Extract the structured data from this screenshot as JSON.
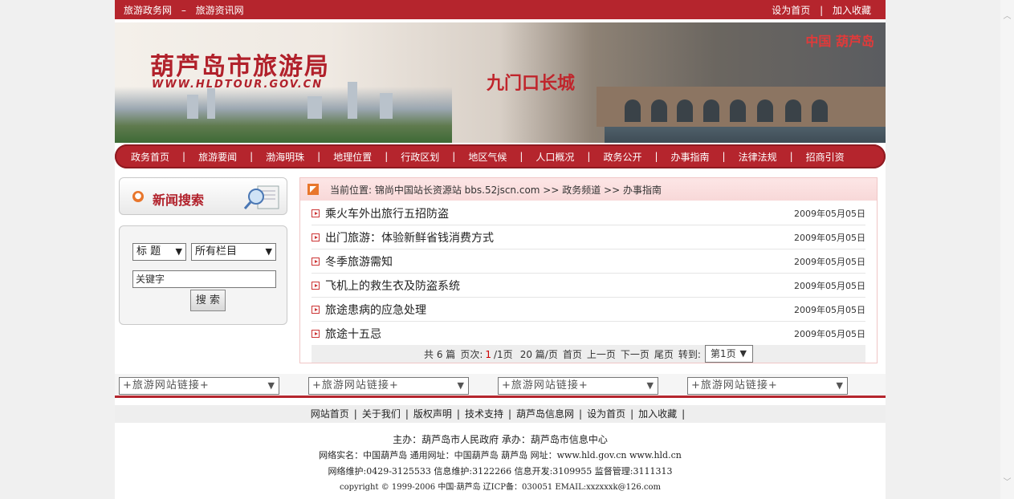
{
  "topbar": {
    "site_name": "旅游政务网",
    "dash": "–",
    "news_site": "旅游资讯网",
    "set_home": "设为首页",
    "sep": "|",
    "add_fav": "加入收藏"
  },
  "banner": {
    "logo_text": "葫芦岛市旅游局",
    "logo_url": "WWW.HLDTOUR.GOV.CN",
    "wall_title": "九门口长城",
    "region": "中国  葫芦岛"
  },
  "nav": {
    "items": [
      "政务首页",
      "旅游要闻",
      "渤海明珠",
      "地理位置",
      "行政区划",
      "地区气候",
      "人口概况",
      "政务公开",
      "办事指南",
      "法律法规",
      "招商引资"
    ],
    "divider": "|"
  },
  "search": {
    "box_title": "新闻搜索",
    "field_select": "标 题",
    "column_select": "所有栏目",
    "keyword_value": "关键字",
    "button": "搜 索"
  },
  "breadcrumb": {
    "text": "当前位置: 锦尚中国站长资源站 bbs.52jscn.com >> 政务频道 >> 办事指南"
  },
  "articles": [
    {
      "title": "乘火车外出旅行五招防盗",
      "date": "2009年05月05日"
    },
    {
      "title": "出门旅游：体验新鲜省钱消费方式",
      "date": "2009年05月05日"
    },
    {
      "title": "冬季旅游需知",
      "date": "2009年05月05日"
    },
    {
      "title": "飞机上的救生衣及防盗系统",
      "date": "2009年05月05日"
    },
    {
      "title": "旅途患病的应急处理",
      "date": "2009年05月05日"
    },
    {
      "title": "旅途十五忌",
      "date": "2009年05月05日"
    }
  ],
  "pager": {
    "total_a": "共 6 篇",
    "page_label": "页次:",
    "current": "1",
    "of_pages": "/1页",
    "per_page": "20 篇/页",
    "first": "首页",
    "prev": "上一页",
    "next": "下一页",
    "last": "尾页",
    "goto": "转到:",
    "page_select": "第1页"
  },
  "site_links": [
    "+旅游网站链接+",
    "+旅游网站链接+",
    "+旅游网站链接+",
    "+旅游网站链接+"
  ],
  "footer_nav": [
    "网站首页",
    "关于我们",
    "版权声明",
    "技术支持",
    "葫芦岛信息网",
    "设为首页",
    "加入收藏"
  ],
  "footer_sep": "|",
  "footer": {
    "line1": "主办：葫芦岛市人民政府    承办：葫芦岛市信息中心",
    "line2": "网络实名：中国葫芦岛  通用网址：中国葫芦岛 葫芦岛   网址：www.hld.gov.cn  www.hld.cn",
    "line3": "网络维护:0429-3125533 信息维护:3122266 信息开发:3109955 监督管理:3111313",
    "line4": "copyright © 1999-2006 中国·葫芦岛  辽ICP备：030051    EMAIL:xxzxxxk@126.com"
  }
}
